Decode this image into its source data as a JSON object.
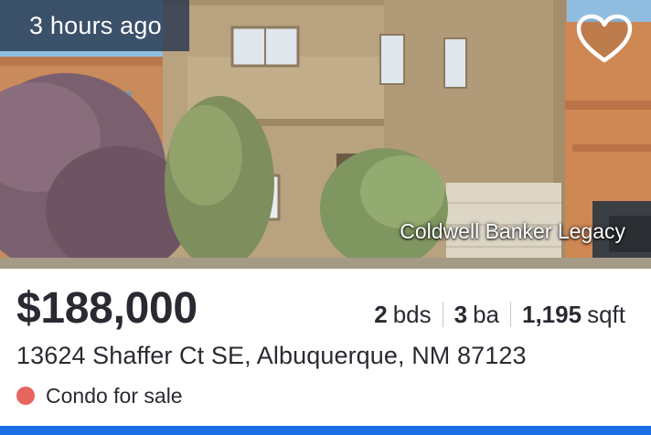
{
  "listing": {
    "time_badge": "3 hours ago",
    "attribution": "Coldwell Banker Legacy",
    "price": "$188,000",
    "beds_value": "2",
    "beds_unit": "bds",
    "baths_value": "3",
    "baths_unit": "ba",
    "sqft_value": "1,195",
    "sqft_unit": "sqft",
    "address": "13624 Shaffer Ct SE, Albuquerque, NM 87123",
    "status": "Condo for sale"
  },
  "icons": {
    "favorite": "heart-outline-icon",
    "status_indicator": "status-dot"
  },
  "colors": {
    "status_dot": "#e6665d",
    "accent_bar": "#1a6ee6",
    "badge_background": "#28384e",
    "text": "#2a2a33"
  }
}
